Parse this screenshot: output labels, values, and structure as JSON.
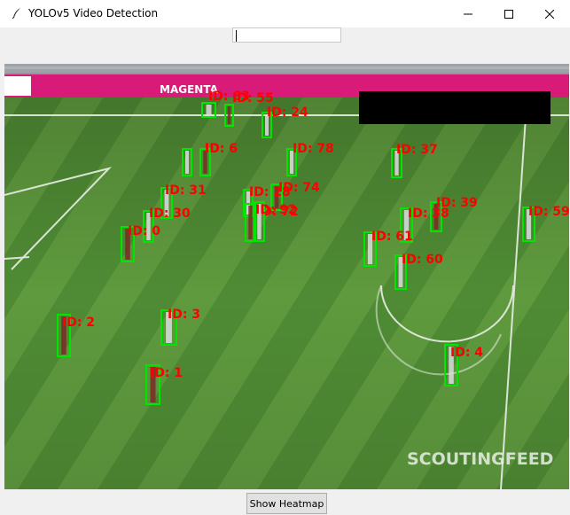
{
  "window": {
    "title": "YOLOv5 Video Detection",
    "app_icon": "feather-icon"
  },
  "text_entry": {
    "value": ""
  },
  "video": {
    "ad_board_text": "MAGENTA",
    "watermark": "SCOUTINGFEED",
    "detections": [
      {
        "label": "ID: 63"
      },
      {
        "label": "ID: 55"
      },
      {
        "label": "ID: 24"
      },
      {
        "label": "ID: 6"
      },
      {
        "label": "ID: 6"
      },
      {
        "label": "ID: 78"
      },
      {
        "label": "ID: 37"
      },
      {
        "label": "ID: 74"
      },
      {
        "label": "ID: 31"
      },
      {
        "label": "ID: 28"
      },
      {
        "label": "ID: 72"
      },
      {
        "label": "ID: 92"
      },
      {
        "label": "ID: 30"
      },
      {
        "label": "ID: 39"
      },
      {
        "label": "ID: 38"
      },
      {
        "label": "ID: 59"
      },
      {
        "label": "ID: 0"
      },
      {
        "label": "ID: 61"
      },
      {
        "label": "ID: 60"
      },
      {
        "label": "ID: 2"
      },
      {
        "label": "ID: 3"
      },
      {
        "label": "ID: 4"
      },
      {
        "label": "ID: 1"
      }
    ]
  },
  "footer": {
    "heatmap_button_label": "Show Heatmap"
  },
  "colors": {
    "box": "#00e600",
    "label": "#ff0000",
    "pitch_light": "#5f9a3e",
    "pitch_dark": "#4e8a33",
    "ad_board": "#d81a78"
  }
}
